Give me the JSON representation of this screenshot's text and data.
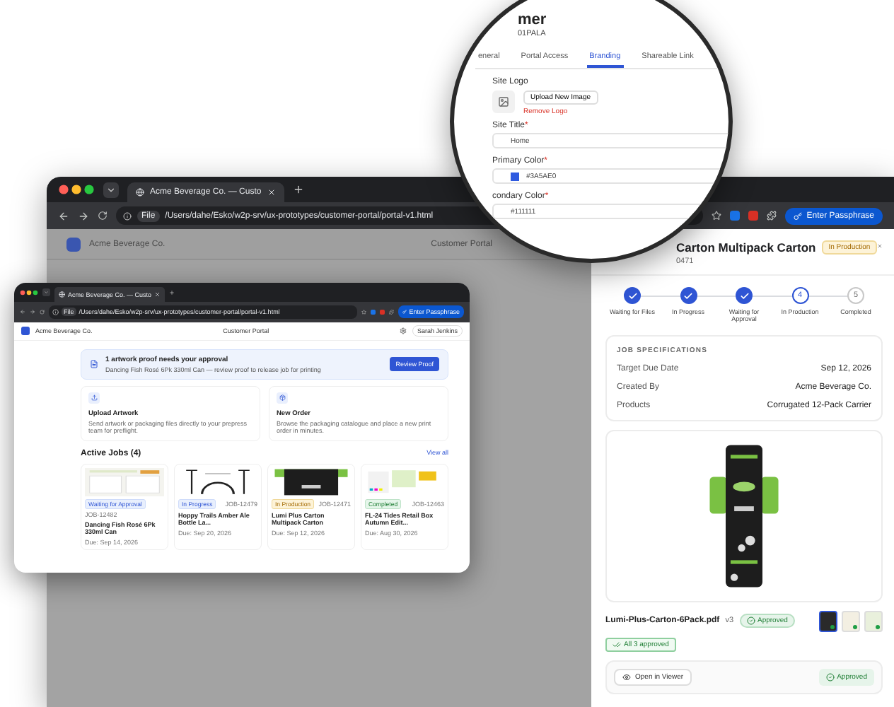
{
  "magnifier": {
    "title": "mer",
    "subtitle": "01PALA",
    "tabs": [
      {
        "label": "eneral",
        "selected": false
      },
      {
        "label": "Portal Access",
        "selected": false
      },
      {
        "label": "Branding",
        "selected": true
      },
      {
        "label": "Shareable Link",
        "selected": false
      }
    ],
    "logo_label": "Site Logo",
    "upload_button": "Upload New Image",
    "remove_link": "Remove Logo",
    "fields": [
      {
        "kind": "text",
        "label": "Site Title",
        "asterisk": "*",
        "value": "Home"
      },
      {
        "kind": "color",
        "label": "Primary Color",
        "asterisk": "*",
        "value": "#3A5AE0",
        "color": "#2f5be0"
      },
      {
        "kind": "text",
        "label": "condary Color",
        "asterisk": "*",
        "value": "#111111"
      }
    ]
  },
  "back_window": {
    "tab_title": "Acme Beverage Co. — Custo",
    "file_chip": "File",
    "url": "/Users/dahe/Esko/w2p-srv/ux-prototypes/customer-portal/portal-v1.html",
    "passphrase_button": "Enter Passphrase",
    "brand": "Acme Beverage Co.",
    "portal_title": "Customer Portal"
  },
  "job_drawer": {
    "title": "Carton Multipack Carton",
    "status": "In Production",
    "job_id": "0471",
    "steps": [
      {
        "label": "Waiting for Files",
        "completed": true,
        "current": false
      },
      {
        "label": "In Progress",
        "completed": true,
        "current": false
      },
      {
        "label": "Waiting for Approval",
        "completed": true,
        "current": false
      },
      {
        "label": "In Production",
        "number": "4",
        "completed": false,
        "current": true
      },
      {
        "label": "Completed",
        "number": "5",
        "completed": false,
        "current": false
      }
    ],
    "specs_title": "JOB SPECIFICATIONS",
    "specs": [
      {
        "label": "Target Due Date",
        "value": "Sep 12, 2026"
      },
      {
        "label": "Created By",
        "value": "Acme Beverage Co."
      },
      {
        "label": "Products",
        "value": "Corrugated 12-Pack Carrier"
      }
    ],
    "file": {
      "name": "Lumi-Plus-Carton-6Pack.pdf",
      "version": "v3",
      "status": "Approved",
      "summary": "All 3 approved"
    },
    "thumbnails": [
      {
        "approved": true,
        "selected": true
      },
      {
        "approved": true,
        "selected": false
      },
      {
        "approved": true,
        "selected": false
      }
    ],
    "viewer_button": "Open in Viewer",
    "approval": "Approved"
  },
  "front_window": {
    "tab_title": "Acme Beverage Co. — Custo",
    "file_chip": "File",
    "url": "/Users/dahe/Esko/w2p-srv/ux-prototypes/customer-portal/portal-v1.html",
    "passphrase_button": "Enter Passphrase",
    "brand": "Acme Beverage Co.",
    "portal_title": "Customer Portal",
    "user": "Sarah Jenkins",
    "banner": {
      "title": "1 artwork proof needs your approval",
      "text": "Dancing Fish Rosé 6Pk 330ml Can — review proof to release job for printing",
      "button": "Review Proof"
    },
    "actions": [
      {
        "kind": "upload",
        "title": "Upload Artwork",
        "text": "Send artwork or packaging files directly to your prepress team for preflight."
      },
      {
        "kind": "order",
        "title": "New Order",
        "text": "Browse the packaging catalogue and place a new print order in minutes."
      }
    ],
    "jobs_title": "Active Jobs (4)",
    "view_all": "View all",
    "jobs": [
      {
        "status": "Waiting for Approval",
        "kind": "approval",
        "id": "JOB-12482",
        "name": "Dancing Fish Rosé 6Pk 330ml Can",
        "due": "Due: Sep 14, 2026"
      },
      {
        "status": "In Progress",
        "kind": "progress",
        "id": "JOB-12479",
        "name": "Hoppy Trails Amber Ale Bottle La...",
        "due": "Due: Sep 20, 2026"
      },
      {
        "status": "In Production",
        "kind": "production",
        "id": "JOB-12471",
        "name": "Lumi Plus Carton Multipack Carton",
        "due": "Due: Sep 12, 2026"
      },
      {
        "status": "Completed",
        "kind": "completed",
        "id": "JOB-12463",
        "name": "FL-24 Tides Retail Box Autumn Edit...",
        "due": "Due: Aug 30, 2026"
      }
    ]
  }
}
